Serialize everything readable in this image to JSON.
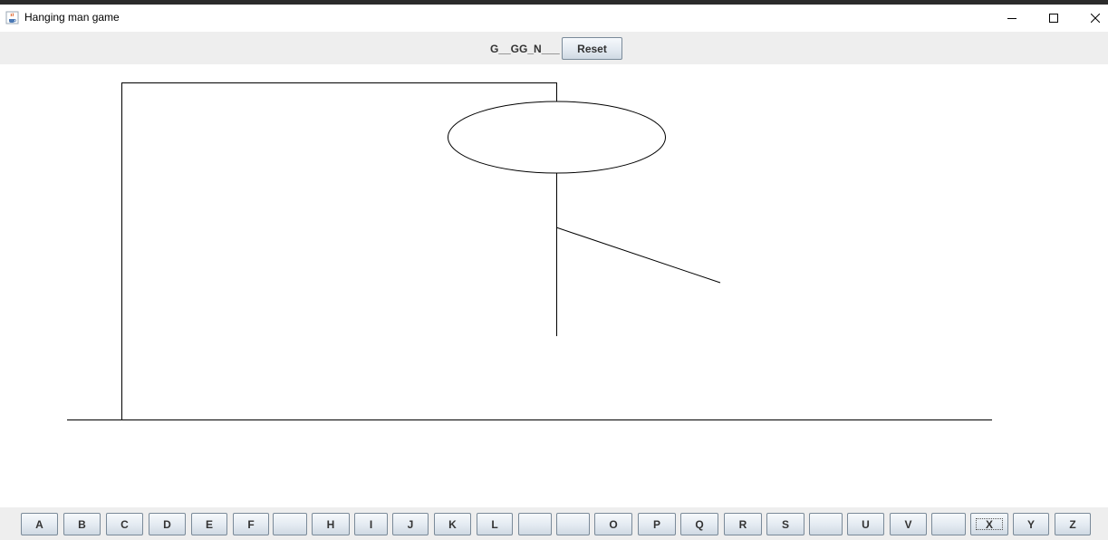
{
  "window": {
    "title": "Hanging man game",
    "icon": "java-cup-icon",
    "controls": [
      "minimize-icon",
      "maximize-icon",
      "close-icon"
    ]
  },
  "toolbar": {
    "word": "G__GG_N___",
    "reset_label": "Reset"
  },
  "drawing": {
    "parts": [
      "gallows-base",
      "gallows-post",
      "gallows-beam",
      "rope",
      "head",
      "body",
      "right-arm"
    ]
  },
  "letters": [
    {
      "label": "A"
    },
    {
      "label": "B"
    },
    {
      "label": "C"
    },
    {
      "label": "D"
    },
    {
      "label": "E"
    },
    {
      "label": "F"
    },
    {
      "label": ""
    },
    {
      "label": "H"
    },
    {
      "label": "I"
    },
    {
      "label": "J"
    },
    {
      "label": "K"
    },
    {
      "label": "L"
    },
    {
      "label": ""
    },
    {
      "label": ""
    },
    {
      "label": "O"
    },
    {
      "label": "P"
    },
    {
      "label": "Q"
    },
    {
      "label": "R"
    },
    {
      "label": "S"
    },
    {
      "label": ""
    },
    {
      "label": "U"
    },
    {
      "label": "V"
    },
    {
      "label": ""
    },
    {
      "label": "X"
    },
    {
      "label": "Y"
    },
    {
      "label": "Z"
    }
  ],
  "colors": {
    "panel": "#eeeeee",
    "canvas": "#ffffff",
    "line": "#000000"
  }
}
